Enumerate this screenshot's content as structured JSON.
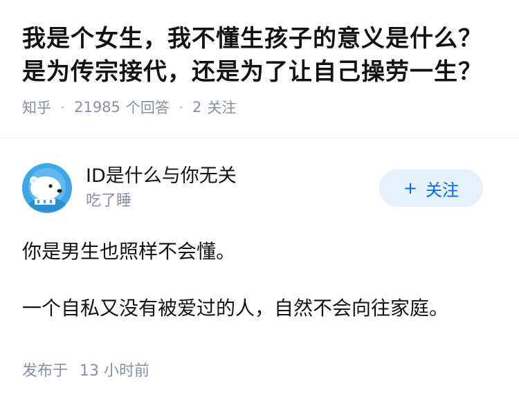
{
  "question": {
    "title": "我是个女生，我不懂生孩子的意义是什么？是为传宗接代，还是为了让自己操劳一生？",
    "source": "知乎",
    "answer_count": "21985",
    "answer_label": "个回答",
    "follow_count": "2",
    "follow_label": "关注"
  },
  "answer": {
    "author_name": "ID是什么与你无关",
    "author_bio": "吃了睡",
    "follow_button": "关注",
    "paragraphs": [
      "你是男生也照样不会懂。",
      "一个自私又没有被爱过的人，自然不会向往家庭。"
    ],
    "published_label": "发布于",
    "published_time": "13 小时前"
  },
  "icons": {
    "avatar": "polar-bear-avatar-icon",
    "follow": "plus-icon"
  },
  "colors": {
    "accent": "#0066ff",
    "meta_text": "#8590a6",
    "button_bg": "#e5f0fb",
    "avatar_bg": "#3fa6e8"
  }
}
